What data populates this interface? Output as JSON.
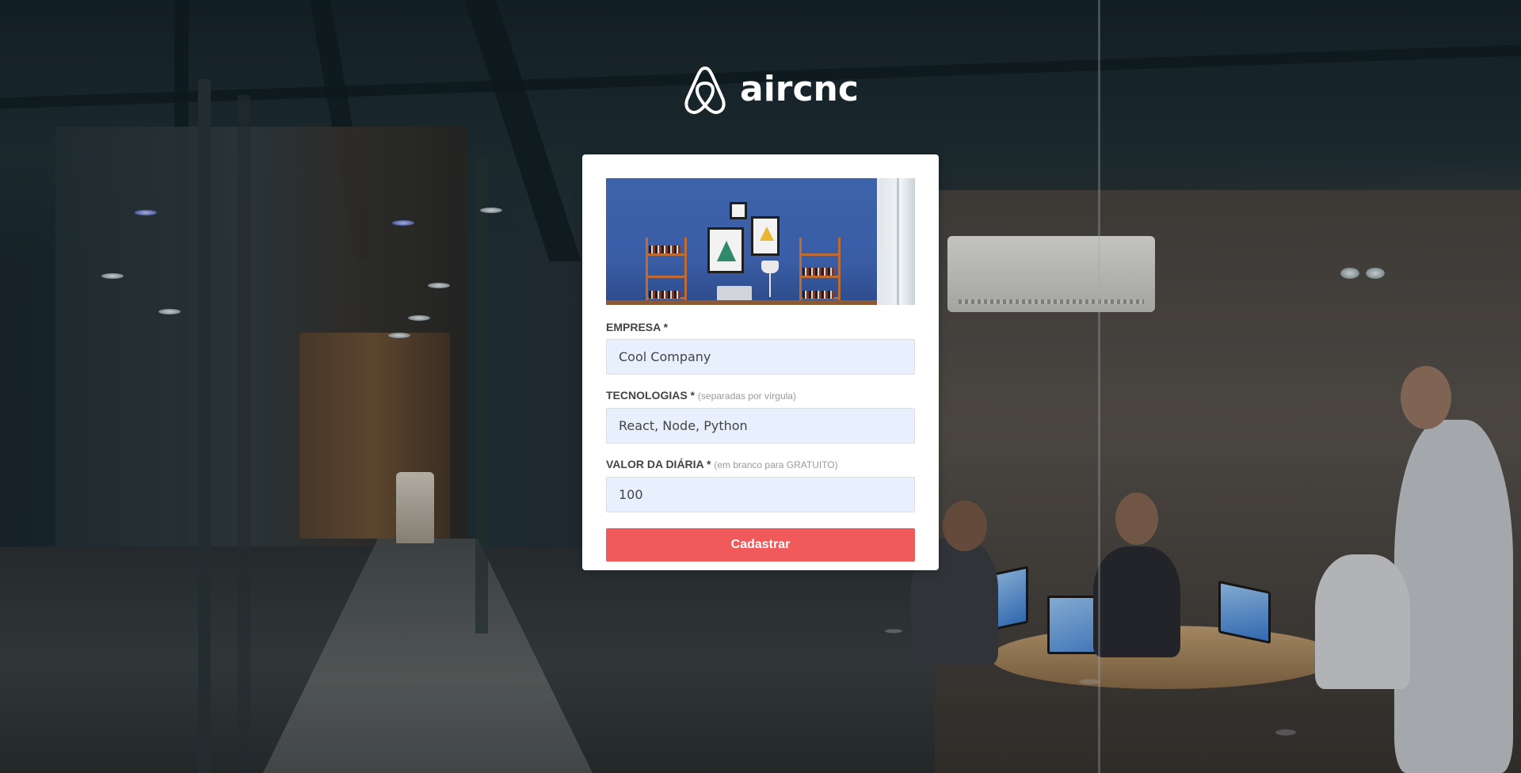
{
  "brand": {
    "name": "aircnc",
    "logo_icon": "airbnb-belo-icon"
  },
  "form": {
    "thumbnail_icon": "room-preview-image",
    "fields": [
      {
        "label": "EMPRESA *",
        "hint": "",
        "value": "Cool Company"
      },
      {
        "label": "TECNOLOGIAS *",
        "hint": "(separadas por vírgula)",
        "value": "React, Node, Python"
      },
      {
        "label": "VALOR DA DIÁRIA *",
        "hint": "(em branco para GRATUITO)",
        "value": "100"
      }
    ],
    "submit_label": "Cadastrar"
  },
  "colors": {
    "accent": "#f05a5b",
    "input_bg": "#e8f0fe",
    "card_bg": "#ffffff"
  }
}
